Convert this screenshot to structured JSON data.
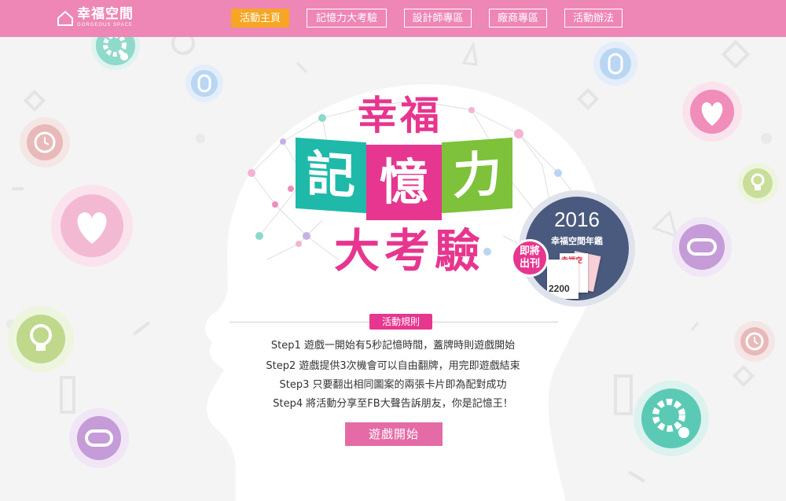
{
  "brand": {
    "name": "幸福空間",
    "sub": "GORGEOUS SPACE"
  },
  "nav": {
    "items": [
      {
        "label": "活動主頁",
        "active": true
      },
      {
        "label": "記憶力大考驗",
        "active": false
      },
      {
        "label": "設計師專區",
        "active": false
      },
      {
        "label": "廠商專區",
        "active": false
      },
      {
        "label": "活動辦法",
        "active": false
      }
    ]
  },
  "title": {
    "line1": "幸福",
    "chars": [
      "記",
      "憶",
      "力"
    ],
    "line3": "大考驗"
  },
  "badge": {
    "year": "2016",
    "subtitle": "幸福空間年鑑",
    "tag": "即將出刊",
    "mag_number": "2200",
    "mag_title": "幸福空間"
  },
  "rules": {
    "label": "活動規則",
    "steps": [
      "Step1 遊戲一開始有5秒記憶時間，蓋牌時則遊戲開始",
      "Step2 遊戲提供3次機會可以自由翻牌，用完即遊戲結束",
      "Step3 只要翻出相同圖案的兩張卡片即為配對成功",
      "Step4 將活動分享至FB大聲告訴朋友，你是記憶王！"
    ]
  },
  "cta": {
    "label": "遊戲開始"
  },
  "colors": {
    "topbar": "#ee86b6",
    "active": "#f6a623",
    "accent": "#e7368f",
    "teal": "#1fb9a9",
    "green": "#7dc23a",
    "button": "#e46ba6"
  },
  "decor_icons": [
    "gear-icon",
    "mouse-icon",
    "clock-icon",
    "heart-icon",
    "lightbulb-icon",
    "gamepad-icon"
  ]
}
